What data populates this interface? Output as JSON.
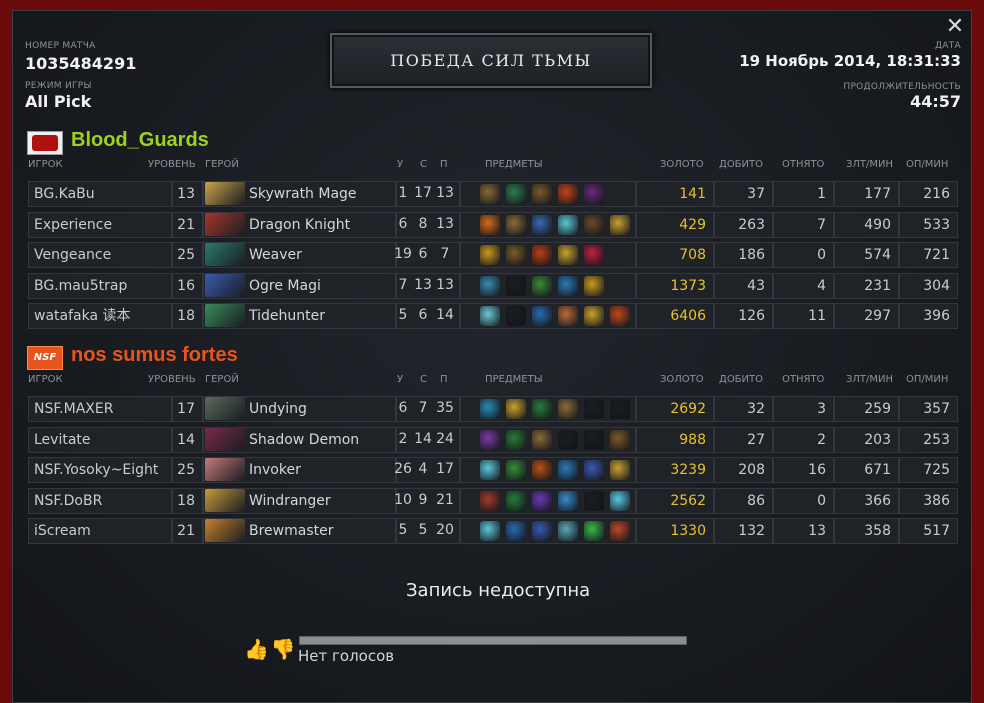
{
  "window": {
    "close_icon": "close-icon"
  },
  "match": {
    "id_label": "НОМЕР МАТЧА",
    "id": "1035484291",
    "mode_label": "РЕЖИМ ИГРЫ",
    "mode": "All Pick",
    "result": "ПОБЕДА СИЛ ТЬМЫ",
    "date_label": "ДАТА",
    "date": "19 Ноябрь 2014, 18:31:33",
    "duration_label": "ПРОДОЛЖИТЕЛЬНОСТЬ",
    "duration": "44:57"
  },
  "columns": {
    "player": "ИГРОК",
    "level": "УРОВЕНЬ",
    "hero": "ГЕРОЙ",
    "kills": "У",
    "deaths": "С",
    "assists": "П",
    "items": "ПРЕДМЕТЫ",
    "gold": "ЗОЛОТО",
    "last_hits": "ДОБИТО",
    "denies": "ОТНЯТО",
    "xpm": "ЗЛТ/МИН",
    "gpm": "ОП/МИН"
  },
  "teams": [
    {
      "name": "Blood_Guards",
      "color": "#9fd11f",
      "logo_icon": "team-logo-icon",
      "players": [
        {
          "player": "BG.KaBu",
          "level": "13",
          "hero": "Skywrath Mage",
          "k": "1",
          "d": "17",
          "a": "13",
          "gold": "141",
          "lh": "37",
          "dn": "1",
          "xpm": "177",
          "gpm": "216",
          "portrait": "#c9a24a",
          "items": [
            "#8a6a3a",
            "#2e7d4f",
            "#7a5a2a",
            "#c0461e",
            "#6a2a7a"
          ]
        },
        {
          "player": "Experience",
          "level": "21",
          "hero": "Dragon Knight",
          "k": "6",
          "d": "8",
          "a": "13",
          "gold": "429",
          "lh": "263",
          "dn": "7",
          "xpm": "490",
          "gpm": "533",
          "portrait": "#a8362a",
          "items": [
            "#d86a1a",
            "#8a6a3a",
            "#3a6ab0",
            "#5ac8d8",
            "#6a4a2a",
            "#c8a030",
            "#2a8a7a"
          ]
        },
        {
          "player": "Vengeance",
          "level": "25",
          "hero": "Weaver",
          "k": "19",
          "d": "6",
          "a": "7",
          "gold": "708",
          "lh": "186",
          "dn": "0",
          "xpm": "574",
          "gpm": "721",
          "portrait": "#2a7a6a",
          "items": [
            "#c89a20",
            "#7a5a2a",
            "#b8401a",
            "#c8a030",
            "#c02040"
          ]
        },
        {
          "player": "BG.mau5trap",
          "level": "16",
          "hero": "Ogre Magi",
          "k": "7",
          "d": "13",
          "a": "13",
          "gold": "1373",
          "lh": "43",
          "dn": "4",
          "xpm": "231",
          "gpm": "304",
          "portrait": "#3a5ab0",
          "items": [
            "#3a8ab0",
            "#1a1d22",
            "#3a8a3a",
            "#2a7ab8",
            "#c89a20"
          ]
        },
        {
          "player": "watafaka 读本",
          "level": "18",
          "hero": "Tidehunter",
          "k": "5",
          "d": "6",
          "a": "14",
          "gold": "6406",
          "lh": "126",
          "dn": "11",
          "xpm": "297",
          "gpm": "396",
          "portrait": "#3a8a5a",
          "items": [
            "#6ac8d8",
            "#1a1d22",
            "#2a6ab0",
            "#b86a3a",
            "#c8a030",
            "#c0461e"
          ]
        }
      ]
    },
    {
      "name": "nos sumus fortes",
      "color": "#e8541e",
      "logo_icon": "team-logo-icon",
      "players": [
        {
          "player": "NSF.MAXER",
          "level": "17",
          "hero": "Undying",
          "k": "6",
          "d": "7",
          "a": "35",
          "gold": "2692",
          "lh": "32",
          "dn": "3",
          "xpm": "259",
          "gpm": "357",
          "portrait": "#5a6a5a",
          "items": [
            "#2a8ab8",
            "#c8a030",
            "#2a7a3a",
            "#8a6a3a",
            "#1a1d22",
            "#1a1d22"
          ]
        },
        {
          "player": "Levitate",
          "level": "14",
          "hero": "Shadow Demon",
          "k": "2",
          "d": "14",
          "a": "24",
          "gold": "988",
          "lh": "27",
          "dn": "2",
          "xpm": "203",
          "gpm": "253",
          "portrait": "#7a2a4a",
          "items": [
            "#7a3aa0",
            "#2a7a3a",
            "#8a6a3a",
            "#1a1d22",
            "#1a1d22",
            "#7a5a2a"
          ]
        },
        {
          "player": "NSF.Yosoky~Eight",
          "level": "25",
          "hero": "Invoker",
          "k": "26",
          "d": "4",
          "a": "17",
          "gold": "3239",
          "lh": "208",
          "dn": "16",
          "xpm": "671",
          "gpm": "725",
          "portrait": "#c87a7a",
          "items": [
            "#5ac8d8",
            "#3a8a3a",
            "#b8501a",
            "#2a7ab8",
            "#3a5ab0",
            "#c8a030"
          ]
        },
        {
          "player": "NSF.DoBR",
          "level": "18",
          "hero": "Windranger",
          "k": "10",
          "d": "9",
          "a": "21",
          "gold": "2562",
          "lh": "86",
          "dn": "0",
          "xpm": "366",
          "gpm": "386",
          "portrait": "#c89a3a",
          "items": [
            "#a03a2a",
            "#2a7a3a",
            "#6a3ab0",
            "#3a8ac8",
            "#1a1d22",
            "#5ac8e8"
          ]
        },
        {
          "player": "iScream",
          "level": "21",
          "hero": "Brewmaster",
          "k": "5",
          "d": "5",
          "a": "20",
          "gold": "1330",
          "lh": "132",
          "dn": "13",
          "xpm": "358",
          "gpm": "517",
          "portrait": "#c8802a",
          "items": [
            "#5ac8d8",
            "#2a6ab0",
            "#3a5ab0",
            "#5aa8b8",
            "#3ab84a",
            "#b84a2a"
          ]
        }
      ]
    }
  ],
  "footer": {
    "record": "Запись недоступна",
    "votes": "Нет голосов",
    "like_icon": "thumbs-up-icon",
    "dislike_icon": "thumbs-down-icon",
    "vote_ratio": 0
  }
}
